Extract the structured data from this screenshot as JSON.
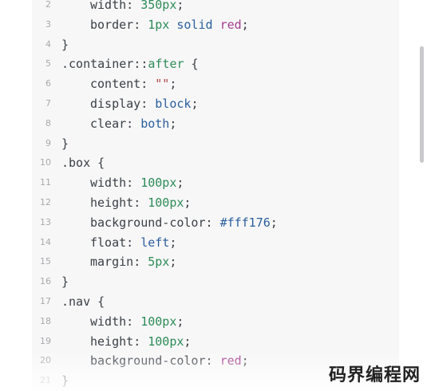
{
  "lines": [
    {
      "n": "2",
      "indent": true,
      "tokens": [
        {
          "t": "width",
          "c": "tok-prop"
        },
        {
          "t": ": ",
          "c": "tok-punc"
        },
        {
          "t": "350px",
          "c": "tok-num"
        },
        {
          "t": ";",
          "c": "tok-punc"
        }
      ]
    },
    {
      "n": "3",
      "indent": true,
      "tokens": [
        {
          "t": "border",
          "c": "tok-prop"
        },
        {
          "t": ": ",
          "c": "tok-punc"
        },
        {
          "t": "1px",
          "c": "tok-num"
        },
        {
          "t": " ",
          "c": "tok-punc"
        },
        {
          "t": "solid",
          "c": "tok-key"
        },
        {
          "t": " ",
          "c": "tok-punc"
        },
        {
          "t": "red",
          "c": "tok-color"
        },
        {
          "t": ";",
          "c": "tok-punc"
        }
      ]
    },
    {
      "n": "4",
      "indent": false,
      "tokens": [
        {
          "t": "}",
          "c": "tok-punc"
        }
      ]
    },
    {
      "n": "5",
      "indent": false,
      "tokens": [
        {
          "t": ".container",
          "c": "tok-sel"
        },
        {
          "t": "::",
          "c": "tok-punc"
        },
        {
          "t": "after",
          "c": "tok-pseudo"
        },
        {
          "t": " {",
          "c": "tok-punc"
        }
      ]
    },
    {
      "n": "6",
      "indent": true,
      "tokens": [
        {
          "t": "content",
          "c": "tok-prop"
        },
        {
          "t": ": ",
          "c": "tok-punc"
        },
        {
          "t": "\"\"",
          "c": "tok-str"
        },
        {
          "t": ";",
          "c": "tok-punc"
        }
      ]
    },
    {
      "n": "7",
      "indent": true,
      "tokens": [
        {
          "t": "display",
          "c": "tok-prop"
        },
        {
          "t": ": ",
          "c": "tok-punc"
        },
        {
          "t": "block",
          "c": "tok-key"
        },
        {
          "t": ";",
          "c": "tok-punc"
        }
      ]
    },
    {
      "n": "8",
      "indent": true,
      "tokens": [
        {
          "t": "clear",
          "c": "tok-prop"
        },
        {
          "t": ": ",
          "c": "tok-punc"
        },
        {
          "t": "both",
          "c": "tok-key"
        },
        {
          "t": ";",
          "c": "tok-punc"
        }
      ]
    },
    {
      "n": "9",
      "indent": false,
      "tokens": [
        {
          "t": "}",
          "c": "tok-punc"
        }
      ]
    },
    {
      "n": "10",
      "indent": false,
      "tokens": [
        {
          "t": ".box",
          "c": "tok-sel"
        },
        {
          "t": " {",
          "c": "tok-punc"
        }
      ]
    },
    {
      "n": "11",
      "indent": true,
      "tokens": [
        {
          "t": "width",
          "c": "tok-prop"
        },
        {
          "t": ": ",
          "c": "tok-punc"
        },
        {
          "t": "100px",
          "c": "tok-num"
        },
        {
          "t": ";",
          "c": "tok-punc"
        }
      ]
    },
    {
      "n": "12",
      "indent": true,
      "tokens": [
        {
          "t": "height",
          "c": "tok-prop"
        },
        {
          "t": ": ",
          "c": "tok-punc"
        },
        {
          "t": "100px",
          "c": "tok-num"
        },
        {
          "t": ";",
          "c": "tok-punc"
        }
      ]
    },
    {
      "n": "13",
      "indent": true,
      "tokens": [
        {
          "t": "background-color",
          "c": "tok-prop"
        },
        {
          "t": ": ",
          "c": "tok-punc"
        },
        {
          "t": "#fff176",
          "c": "tok-key"
        },
        {
          "t": ";",
          "c": "tok-punc"
        }
      ]
    },
    {
      "n": "14",
      "indent": true,
      "tokens": [
        {
          "t": "float",
          "c": "tok-prop"
        },
        {
          "t": ": ",
          "c": "tok-punc"
        },
        {
          "t": "left",
          "c": "tok-key"
        },
        {
          "t": ";",
          "c": "tok-punc"
        }
      ]
    },
    {
      "n": "15",
      "indent": true,
      "tokens": [
        {
          "t": "margin",
          "c": "tok-prop"
        },
        {
          "t": ": ",
          "c": "tok-punc"
        },
        {
          "t": "5px",
          "c": "tok-num"
        },
        {
          "t": ";",
          "c": "tok-punc"
        }
      ]
    },
    {
      "n": "16",
      "indent": false,
      "tokens": [
        {
          "t": "}",
          "c": "tok-punc"
        }
      ]
    },
    {
      "n": "17",
      "indent": false,
      "tokens": [
        {
          "t": ".nav",
          "c": "tok-sel"
        },
        {
          "t": " {",
          "c": "tok-punc"
        }
      ]
    },
    {
      "n": "18",
      "indent": true,
      "tokens": [
        {
          "t": "width",
          "c": "tok-prop"
        },
        {
          "t": ": ",
          "c": "tok-punc"
        },
        {
          "t": "100px",
          "c": "tok-num"
        },
        {
          "t": ";",
          "c": "tok-punc"
        }
      ]
    },
    {
      "n": "19",
      "indent": true,
      "tokens": [
        {
          "t": "height",
          "c": "tok-prop"
        },
        {
          "t": ": ",
          "c": "tok-punc"
        },
        {
          "t": "100px",
          "c": "tok-num"
        },
        {
          "t": ";",
          "c": "tok-punc"
        }
      ]
    },
    {
      "n": "20",
      "indent": true,
      "tokens": [
        {
          "t": "background-color",
          "c": "tok-prop"
        },
        {
          "t": ": ",
          "c": "tok-punc"
        },
        {
          "t": "red",
          "c": "tok-color"
        },
        {
          "t": ";",
          "c": "tok-punc"
        }
      ]
    },
    {
      "n": "21",
      "indent": false,
      "tokens": [
        {
          "t": "}",
          "c": "tok-punc"
        }
      ]
    }
  ],
  "watermark": "码界编程网"
}
